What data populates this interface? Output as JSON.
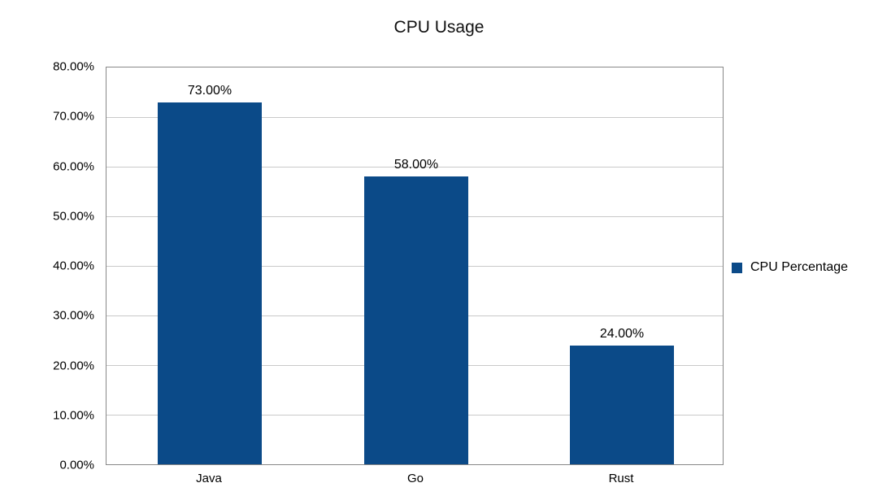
{
  "chart_data": {
    "type": "bar",
    "title": "CPU Usage",
    "categories": [
      "Java",
      "Go",
      "Rust"
    ],
    "values": [
      73.0,
      58.0,
      24.0
    ],
    "data_labels": [
      "73.00%",
      "58.00%",
      "24.00%"
    ],
    "ylim": [
      0,
      80
    ],
    "y_ticks": [
      0,
      10,
      20,
      30,
      40,
      50,
      60,
      70,
      80
    ],
    "y_tick_labels": [
      "0.00%",
      "10.00%",
      "20.00%",
      "30.00%",
      "40.00%",
      "50.00%",
      "60.00%",
      "70.00%",
      "80.00%"
    ],
    "series_name": "CPU Percentage",
    "legend_position": "right",
    "grid": true,
    "xlabel": "",
    "ylabel": "",
    "bar_color": "#0b4a88"
  }
}
